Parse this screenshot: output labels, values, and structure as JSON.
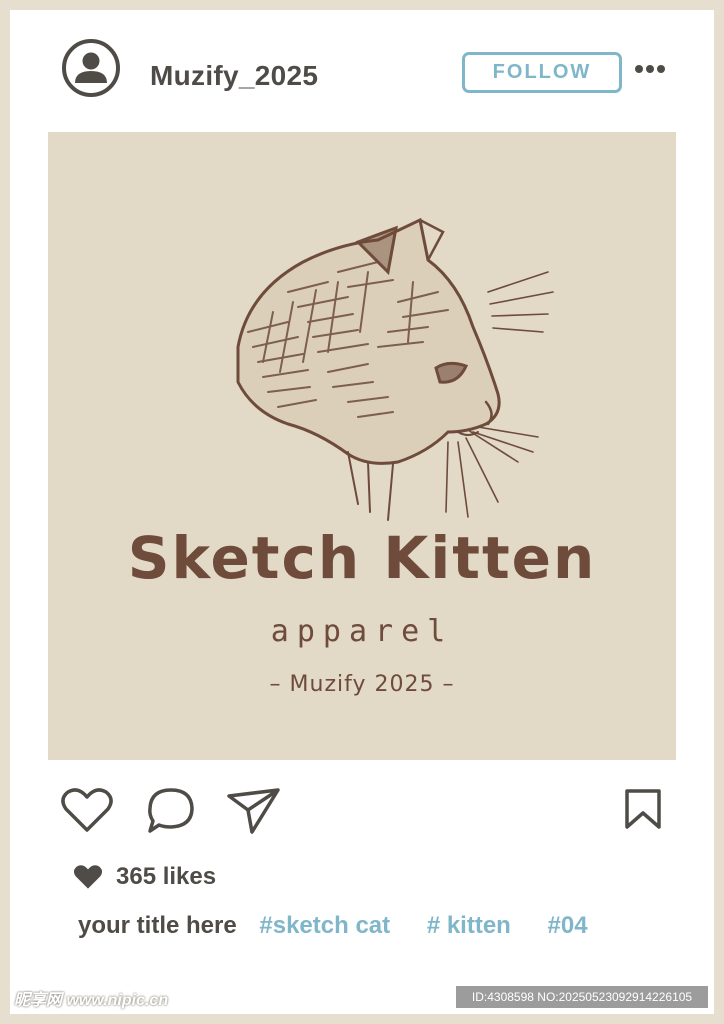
{
  "header": {
    "username": "Muzify_2025",
    "follow_label": "FOLLOW"
  },
  "post": {
    "brand_title": "Sketch Kitten",
    "brand_subtitle": "apparel",
    "brand_tag": "– Muzify 2025 –"
  },
  "actions": {
    "icons": [
      "heart-icon",
      "comment-icon",
      "share-icon",
      "bookmark-icon"
    ]
  },
  "likes": {
    "text": "365 likes"
  },
  "caption": {
    "title": "your title here",
    "tags": [
      "#sketch cat",
      "# kitten",
      "#04"
    ]
  },
  "footer": {
    "watermark": "昵享网 www.nipic.cn",
    "id_text": "ID:4308598 NO:20250523092914226105"
  },
  "colors": {
    "text": "#4f4c48",
    "accent": "#7fb6c9",
    "frame": "#e6dfd0",
    "photo_bg": "#e2d9c7",
    "sketch_brown": "#6e4b3a"
  }
}
